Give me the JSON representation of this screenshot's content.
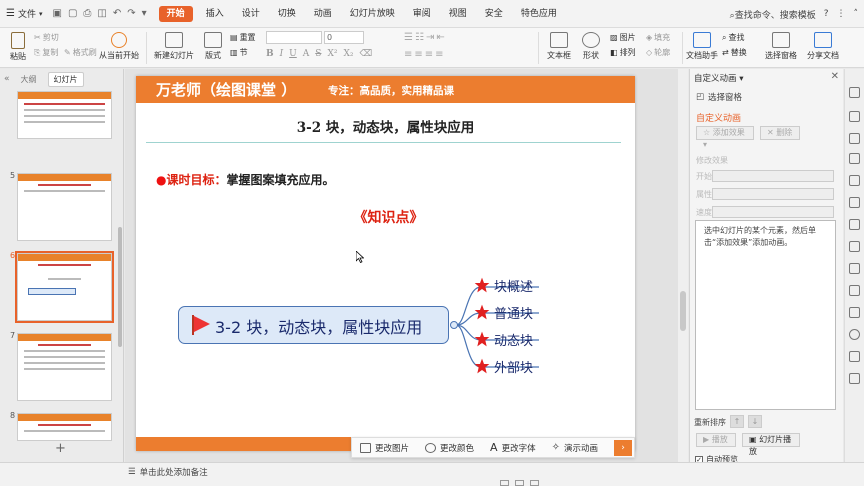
{
  "menu": {
    "file_label": "文件",
    "tabs": [
      "开始",
      "插入",
      "设计",
      "切换",
      "动画",
      "幻灯片放映",
      "审阅",
      "视图",
      "安全",
      "特色应用"
    ],
    "active_tab": "开始",
    "search_label": "查找命令、搜索模板"
  },
  "ribbon": {
    "paste": "粘贴",
    "cut": "剪切",
    "copy": "复制",
    "format_painter": "格式刷",
    "from_current": "从当前开始",
    "new_slide": "新建幻灯片",
    "layout": "版式",
    "reset": "重置",
    "section": "节",
    "font_size": "0",
    "textbox": "文本框",
    "shape": "形状",
    "picture": "图片",
    "fill": "填充",
    "arrange": "排列",
    "outline": "轮廓",
    "doc_assistant": "文档助手",
    "find": "查找",
    "replace": "替换",
    "selection_pane": "选择窗格",
    "share_doc": "分享文档"
  },
  "left_pane": {
    "tab_outline": "大纲",
    "tab_slides": "幻灯片",
    "slide_numbers": [
      "5",
      "6",
      "7",
      "8"
    ],
    "selected": "6"
  },
  "slide": {
    "header_title": "万老师（绘图课堂 ）",
    "header_subtitle": "专注：高品质，实用精品课",
    "title": "3-2 块，动态块，属性块应用",
    "goal_label": "课时目标：",
    "goal_text": "掌握图案填充应用。",
    "knowledge_point": "《知识点》",
    "central_topic": "3-2 块，动态块，属性块应用",
    "branches": [
      "块概述",
      "普通块",
      "动态块",
      "外部块"
    ]
  },
  "floatbar": {
    "change_picture": "更改图片",
    "change_color": "更改颜色",
    "change_font": "更改字体",
    "demo_animation": "演示动画"
  },
  "task_pane": {
    "title": "自定义动画",
    "selection_pane": "选择窗格",
    "section_title": "自定义动画",
    "add_effect": "添加效果",
    "delete": "删除",
    "modify_effect": "修改效果",
    "start_label": "开始:",
    "property_label": "属性:",
    "speed_label": "速度:",
    "hint": "选中幻灯片的某个元素，然后单击“添加效果”添加动画。",
    "reorder": "重新排序",
    "play": "播放",
    "slideshow": "幻灯片播放",
    "auto_preview": "自动预览"
  },
  "status": {
    "notes_hint": "单击此处添加备注"
  },
  "colors": {
    "accent": "#e8622a",
    "header": "#ec7d2f",
    "topic_fill": "#dde9f8",
    "topic_border": "#4a74b3",
    "star": "#e02020"
  }
}
